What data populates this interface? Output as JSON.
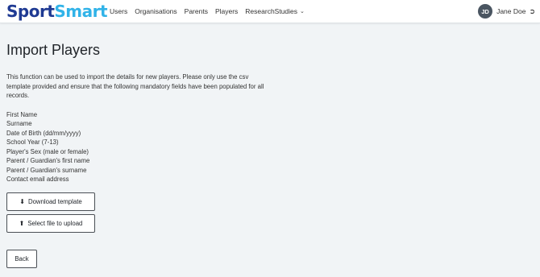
{
  "header": {
    "logo_part1": "Sport",
    "logo_part2": "Smart",
    "nav": [
      {
        "label": "Users"
      },
      {
        "label": "Organisations"
      },
      {
        "label": "Parents"
      },
      {
        "label": "Players"
      },
      {
        "label": "ResearchStudies"
      }
    ],
    "user": {
      "initials": "JD",
      "name": "Jane Doe"
    }
  },
  "page": {
    "title": "Import Players",
    "intro": "This function can be used to import the details for new players. Please only use the csv template provided and ensure that the following mandatory fields have been populated for all records.",
    "fields": [
      "First Name",
      "Surname",
      "Date of Birth (dd/mm/yyyy)",
      "School Year (7-13)",
      "Player's Sex (male or female)",
      "Parent / Guardian's first name",
      "Parent / Guardian's surname",
      "Contact email address"
    ],
    "download_label": "Download template",
    "upload_label": "Select file to upload",
    "back_label": "Back"
  },
  "colors": {
    "logo_dark": "#1f3a93",
    "logo_light": "#31b3e8",
    "background": "#f1f4f6"
  },
  "icons": {
    "download": "download-icon",
    "upload": "upload-icon",
    "logout": "logout-icon",
    "chevron": "chevron-down-icon"
  }
}
